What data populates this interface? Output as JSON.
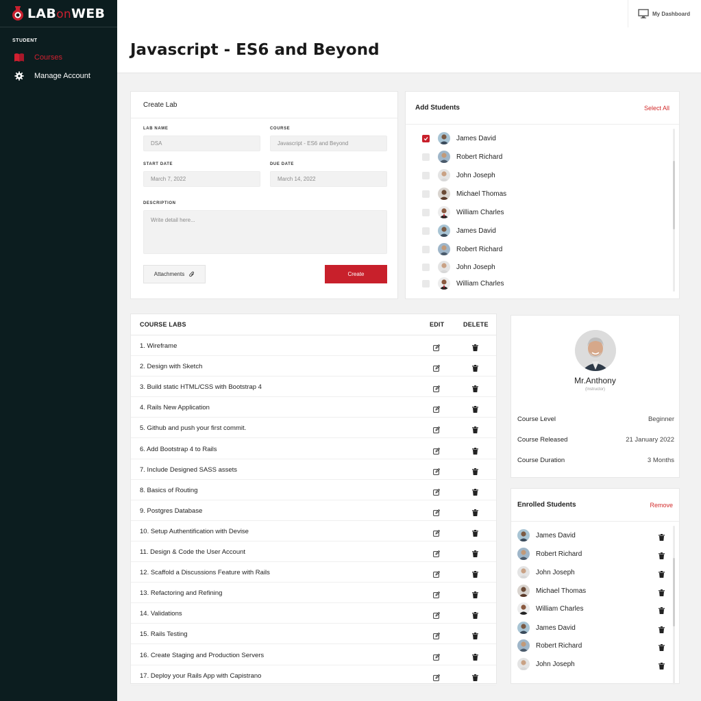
{
  "brand": {
    "part1": "LAB",
    "part2": "on",
    "part3": "WEB"
  },
  "sidebar": {
    "section": "STUDENT",
    "items": [
      {
        "label": "Courses",
        "icon": "book-icon",
        "active": true
      },
      {
        "label": "Manage Account",
        "icon": "gear-icon",
        "active": false
      }
    ]
  },
  "header": {
    "dashboard_label": "My Dashboard",
    "title": "Javascript - ES6 and Beyond"
  },
  "create_lab": {
    "title": "Create Lab",
    "lab_name_label": "LAB NAME",
    "lab_name_value": "DSA",
    "course_label": "COURSE",
    "course_value": "Javascript - ES6 and Beyond",
    "start_label": "START DATE",
    "start_value": "March 7, 2022",
    "due_label": "DUE DATE",
    "due_value": "March 14, 2022",
    "desc_label": "DESCRIPTION",
    "desc_placeholder": "Write detail here...",
    "attach_label": "Attachments",
    "create_label": "Create"
  },
  "add_students": {
    "title": "Add Students",
    "select_all": "Select All",
    "students": [
      {
        "name": "James David",
        "checked": true
      },
      {
        "name": "Robert Richard",
        "checked": false
      },
      {
        "name": "John Joseph",
        "checked": false
      },
      {
        "name": "Michael Thomas",
        "checked": false
      },
      {
        "name": "William Charles",
        "checked": false
      },
      {
        "name": "James David",
        "checked": false
      },
      {
        "name": "Robert Richard",
        "checked": false
      },
      {
        "name": "John Joseph",
        "checked": false
      },
      {
        "name": "William Charles",
        "checked": false
      }
    ]
  },
  "course_labs": {
    "col_name": "COURSE LABS",
    "col_edit": "EDIT",
    "col_delete": "DELETE",
    "labs": [
      "1. Wireframe",
      "2. Design with Sketch",
      "3. Build static HTML/CSS with Bootstrap 4",
      "4. Rails New Application",
      "5. Github and push your first commit.",
      "6. Add Bootstrap 4 to Rails",
      "7. Include Designed SASS assets",
      "8. Basics of Routing",
      "9. Postgres Database",
      "10. Setup Authentification with Devise",
      "11. Design & Code the User Account",
      "12. Scaffold a Discussions Feature with Rails",
      "13. Refactoring and Refining",
      "14. Validations",
      "15. Rails Testing",
      "16. Create Staging and Production Servers",
      "17. Deploy your Rails App with Capistrano"
    ]
  },
  "instructor": {
    "name": "Mr.Anthony",
    "role": "(Instructor)",
    "info": [
      {
        "key": "Course Level",
        "value": "Beginner"
      },
      {
        "key": "Course Released",
        "value": "21 January 2022"
      },
      {
        "key": "Course Duration",
        "value": "3 Months"
      }
    ]
  },
  "enrolled": {
    "title": "Enrolled Students",
    "remove": "Remove",
    "students": [
      "James David",
      "Robert Richard",
      "John Joseph",
      "Michael Thomas",
      "William Charles",
      "James David",
      "Robert Richard",
      "John Joseph"
    ]
  },
  "colors": {
    "accent": "#c8202b",
    "sidebar": "#0c1d1f"
  }
}
